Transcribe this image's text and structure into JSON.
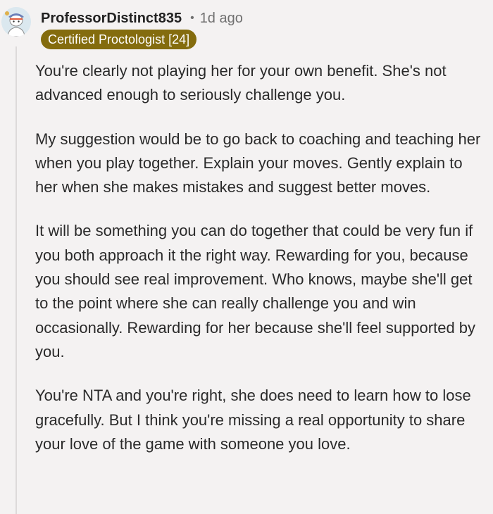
{
  "comment": {
    "username": "ProfessorDistinct835",
    "separator": "•",
    "timestamp": "1d ago",
    "flair": "Certified Proctologist [24]",
    "paragraphs": [
      "You're clearly not playing her for your own benefit. She's not advanced enough to seriously challenge you.",
      "My suggestion would be to go back to coaching and teaching her when you play together. Explain your moves. Gently explain to her when she makes mistakes and suggest better moves.",
      "It will be something you can do together that could be very fun if you both approach it the right way. Rewarding for you, because you should see real improvement. Who knows, maybe she'll get to the point where she can really challenge you and win occasionally. Rewarding for her because she'll feel supported by you.",
      "You're NTA and you're right, she does need to learn how to lose gracefully. But I think you're missing a real opportunity to share your love of the game with someone you love."
    ]
  },
  "colors": {
    "background": "#f4f2f2",
    "flair_background": "#846c0e",
    "flair_text": "#ffffff",
    "meta_text": "#707070"
  },
  "icons": {
    "avatar": "user-avatar-icon"
  }
}
